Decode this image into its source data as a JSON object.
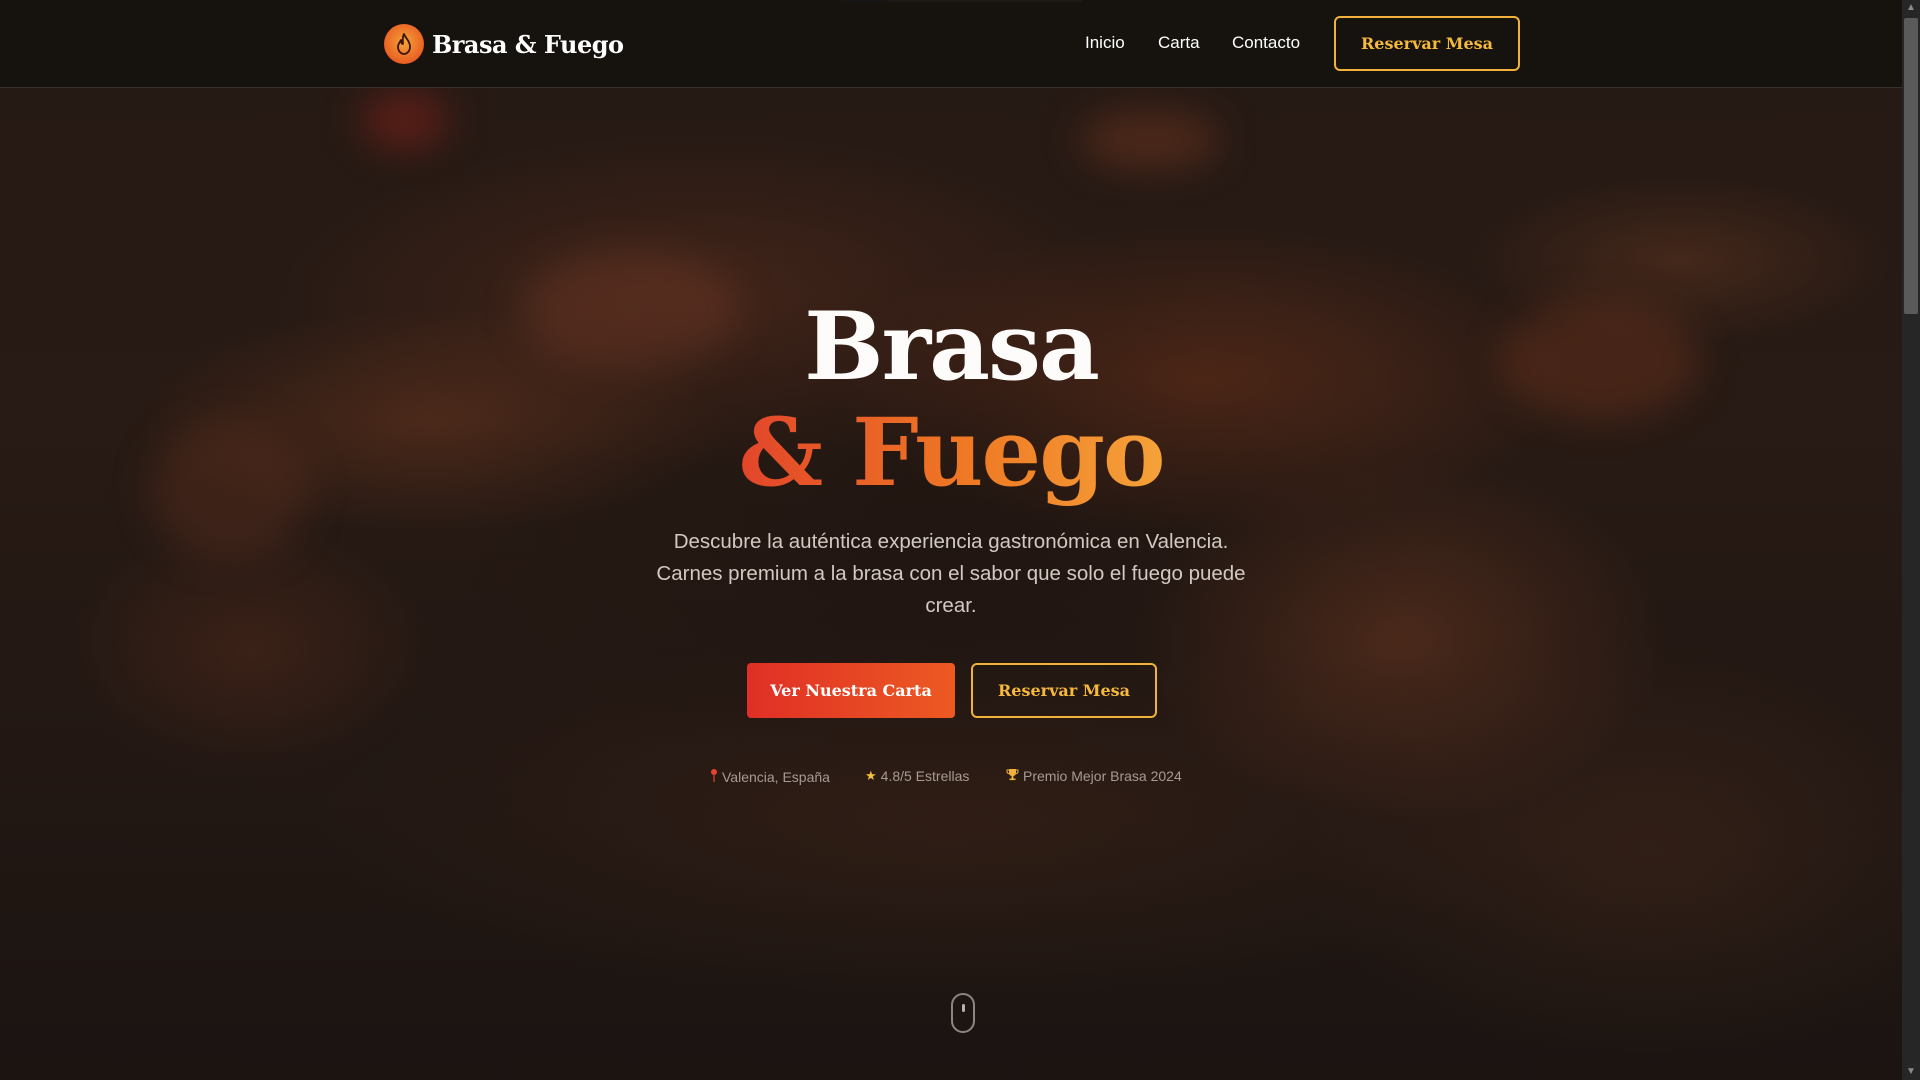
{
  "brand": {
    "name": "Brasa & Fuego",
    "logo_icon": "flame-icon"
  },
  "nav": {
    "links": [
      "Inicio",
      "Carta",
      "Contacto"
    ],
    "cta": "Reservar Mesa"
  },
  "hero": {
    "title_line1": "Brasa",
    "title_line2": "& Fuego",
    "subtitle": "Descubre la auténtica experiencia gastronómica en Valencia. Carnes premium a la brasa con el sabor que solo el fuego puede crear.",
    "primary_button": "Ver Nuestra Carta",
    "secondary_button": "Reservar Mesa",
    "badges": [
      {
        "icon": "map-pin-icon",
        "text": "Valencia, España"
      },
      {
        "icon": "star-icon",
        "text": "4.8/5 Estrellas"
      },
      {
        "icon": "trophy-icon",
        "text": "Premio Mejor Brasa 2024"
      }
    ]
  },
  "colors": {
    "accent_gold": "#f0b23a",
    "accent_red": "#e02f26",
    "accent_orange": "#ef7a24",
    "background": "#1a1613"
  }
}
